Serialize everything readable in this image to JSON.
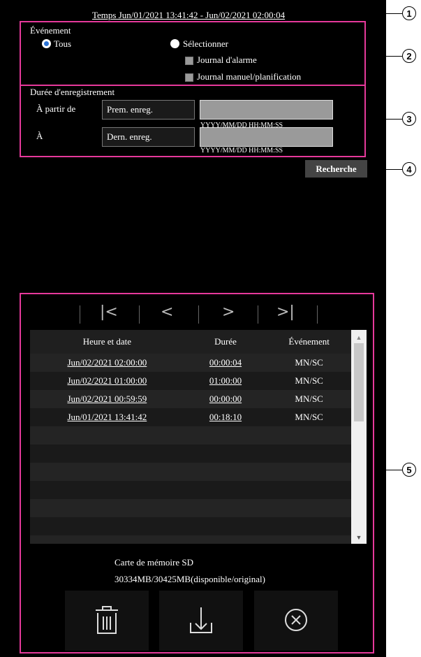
{
  "period": "Temps Jun/01/2021 13:41:42 - Jun/02/2021 02:00:04",
  "event": {
    "title": "Événement",
    "all_label": "Tous",
    "select_label": "Sélectionner",
    "alarm_log_label": "Journal d'alarme",
    "manual_log_label": "Journal manuel/planification"
  },
  "duration": {
    "title": "Durée d'enregistrement",
    "from_label": "À partir de",
    "to_label": "À",
    "from_value": "Prem. enreg.",
    "to_value": "Dern. enreg.",
    "format_hint": "YYYY/MM/DD HH:MM:SS"
  },
  "search_label": "Recherche",
  "nav": {
    "first": "|<",
    "prev": "<",
    "next": ">",
    "last": ">|"
  },
  "table": {
    "headers": [
      "Heure et date",
      "Durée",
      "Événement"
    ],
    "rows": [
      [
        "Jun/02/2021  02:00:00",
        "00:00:04",
        "MN/SC"
      ],
      [
        "Jun/02/2021  01:00:00",
        "01:00:00",
        "MN/SC"
      ],
      [
        "Jun/02/2021  00:59:59",
        "00:00:00",
        "MN/SC"
      ],
      [
        "Jun/01/2021  13:41:42",
        "00:18:10",
        "MN/SC"
      ]
    ]
  },
  "sd": {
    "title": "Carte de mémoire SD",
    "capacity": "30334MB/30425MB(disponible/original)"
  },
  "callouts": [
    "1",
    "2",
    "3",
    "4",
    "5"
  ],
  "colors": {
    "highlight": "#e6399b",
    "radio_accent": "#2b73d6",
    "background": "#000000"
  }
}
